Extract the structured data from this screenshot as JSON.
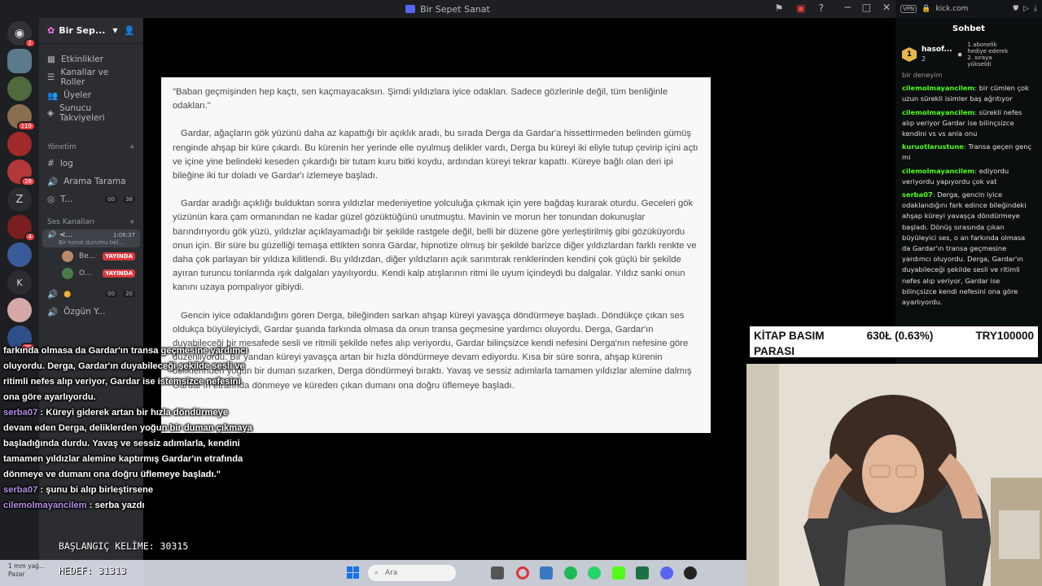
{
  "discord": {
    "window_title": "Bir Sepet Sanat",
    "server_name": "Bir Sep...",
    "nav_items": [
      {
        "label": "Etkinlikler",
        "icon": "calendar-icon"
      },
      {
        "label": "Kanallar ve Roller",
        "icon": "list-icon"
      },
      {
        "label": "Üyeler",
        "icon": "users-icon"
      },
      {
        "label": "Sunucu Takviyeleri",
        "icon": "boost-icon"
      }
    ],
    "category_yonetim": "Yönetim",
    "channels_yonetim": [
      {
        "label": "log",
        "icon": "text-channel-icon"
      },
      {
        "label": "Arama Tarama",
        "icon": "voice-icon"
      },
      {
        "label": "T...",
        "icon": "stage-icon",
        "count_a": "00",
        "count_b": "38"
      }
    ],
    "category_ses": "Ses Kanalları",
    "voice_channel": {
      "label": "<...",
      "time": "1:06:37",
      "status": "Bir kanal durumu bel..."
    },
    "voice_users": [
      {
        "name": "Be...",
        "badge": "YAYINDA"
      },
      {
        "name": "O...",
        "badge": "YAYINDA"
      }
    ],
    "channels_more": [
      {
        "label": "",
        "count_a": "00",
        "count_b": "20"
      },
      {
        "label": "Özgün Y..."
      }
    ],
    "server_badges": [
      "2",
      "119",
      "28",
      "4",
      "26"
    ],
    "server_letters": [
      "K"
    ]
  },
  "document": {
    "paragraphs": [
      "\"Baban geçmişinden hep kaçtı, sen kaçmayacaksın. Şimdi yıldızlara iyice odaklan. Sadece gözlerinle değil, tüm benliğinle odaklan.\"",
      "Gardar, ağaçların gök yüzünü daha az kapattığı bir açıklık aradı, bu sırada Derga da Gardar'a hissettirmeden belinden gümüş renginde ahşap bir küre çıkardı. Bu kürenin her yerinde elle oyulmuş delikler vardı, Derga bu küreyi iki eliyle tutup çevirip içini açtı ve içine yine belindeki keseden çıkardığı bir tutam kuru bitki koydu, ardından küreyi tekrar kapattı. Küreye bağlı olan deri ipi bileğine iki tur doladı ve Gardar'ı izlemeye başladı.",
      "Gardar aradığı açıklığı bulduktan sonra yıldızlar medeniyetine yolculuğa çıkmak için yere bağdaş kurarak oturdu. Geceleri gök yüzünün kara çam ormanından ne kadar güzel gözüktüğünü unutmuştu. Mavinin ve morun her tonundan dokunuşlar barındırıyordu gök yüzü, yıldızlar açıklayamadığı bir şekilde rastgele değil, belli bir düzene göre yerleştirilmiş gibi gözüküyordu onun için. Bir süre bu güzelliği temaşa ettikten sonra Gardar, hipnotize olmuş bir şekilde barizce diğer yıldızlardan farklı renkte ve daha çok parlayan bir yıldıza kilitlendi. Bu yıldızdan, diğer yıldızların açık sarımtırak renklerinden kendini çok güçlü bir şekilde ayıran turuncu tonlarında ışık dalgaları yayılıyordu. Kendi kalp atışlarının ritmi ile uyum içindeydi bu dalgalar. Yıldız sanki onun kanını uzaya pompalıyor gibiydi.",
      "Gencin iyice odaklandığını gören Derga, bileğinden sarkan ahşap küreyi yavaşça döndürmeye başladı. Döndükçe çıkan ses oldukça büyüleyiciydi, Gardar şuanda farkında olmasa da onun transa geçmesine yardımcı oluyordu. Derga, Gardar'ın duyabileceği bir mesafede sesli ve ritmili şekilde nefes alıp veriyordu, Gardar bilinçsizce kendi nefesini Derga'nın nefesine göre düzenliyordu. Bir yandan küreyi yavaşça artan bir hızla döndürmeye devam ediyordu. Kısa bir süre sonra, ahşap kürenin deliklerinden yoğun bir duman sızarken, Derga döndürmeyi bıraktı. Yavaş ve sessiz adımlarla tamamen yıldızlar alemine dalmış Gardar'ın etrafında dönmeye ve küreden çıkan dumanı ona doğru üflemeye başladı."
    ]
  },
  "kick": {
    "url": "kick.com",
    "vpn_label": "VPN",
    "chat_title": "Sohbet",
    "top_user": {
      "rank": "1",
      "name": "hasof...",
      "count": "2"
    },
    "sub_notice": "1 abonelik hediye ederek 2. sıraya yükseldi",
    "partial_top": "bir deneyim",
    "messages": [
      {
        "user": "cilemolmayancilem",
        "text": "bir cümlen çok uzun sürekli isimler baş ağrıtıyor"
      },
      {
        "user": "cilemolmayancilem",
        "text": "sürekli nefes alıp veriyor Gardar ise bilinçsizce kendini vs vs anla onu"
      },
      {
        "user": "kuruotlarustune",
        "text": "Transa geçen genç mi"
      },
      {
        "user": "cilemolmayancilem",
        "text": "ediyordu veriyordu yapıyordu çok vat"
      },
      {
        "user": "serba07",
        "text": "Derga, gencin iyice odaklandığını fark edince bileğindeki ahşap küreyi yavaşça döndürmeye başladı. Dönüş sırasında çıkan büyüleyici ses, o an farkında olmasa da Gardar'ın transa geçmesine yardımcı oluyordu. Derga, Gardar'ın duyabileceği şekilde sesli ve ritimli nefes alıp veriyor, Gardar ise bilinçsizce kendi nefesini ona göre ayarlıyordu."
      }
    ]
  },
  "overlay_chat": {
    "lead_text": "farkında olmasa da Gardar'ın transa geçmesine yardımcı oluyordu. Derga, Gardar'ın duyabileceği şekilde sesli ve ritimli nefes alıp veriyor, Gardar ise istemsizce nefesini ona göre ayarlıyordu.",
    "messages": [
      {
        "user": "serba07",
        "text": ": Küreyi giderek artan bir hızla döndürmeye devam eden Derga, deliklerden yoğun bir duman çıkmaya başladığında durdu. Yavaş ve sessiz adımlarla, kendini tamamen yıldızlar alemine kaptırmış Gardar'ın etrafında dönmeye ve dumanı ona doğru üflemeye başladı.\""
      },
      {
        "user": "serba07",
        "text": ": şunu bi alıp birleştirsene"
      },
      {
        "user": "cilemolmayancilem",
        "text": ": serba yazdı"
      }
    ]
  },
  "counters": {
    "start_label": "BAŞLANGIÇ KELİME: 30315",
    "goal_label": "HEDEF: 31313"
  },
  "donation": {
    "title_line1": "KİTAP BASIM",
    "title_line2": "PARASI",
    "amount": "630Ł (0.63%)",
    "goal": "TRY100000",
    "progress_fraction": 0.0063
  },
  "taskbar": {
    "weather_line1": "1 mm yağ...",
    "weather_line2": "Pazar",
    "search_placeholder": "Ara"
  },
  "colors": {
    "discord_bg": "#313338",
    "kick_green": "#53fc18",
    "live_red": "#da373c",
    "overlay_user": "#b68ee8"
  }
}
